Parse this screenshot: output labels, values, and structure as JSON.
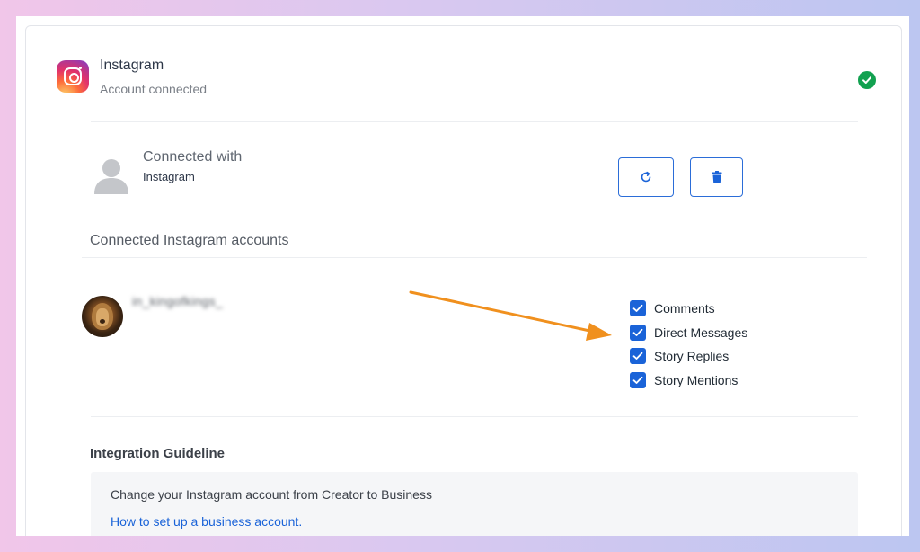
{
  "app": {
    "title": "Instagram",
    "status": "Account connected",
    "connected_icon": "check-circle-icon",
    "status_color": "#12a150"
  },
  "connection": {
    "title": "Connected with",
    "provider": "Instagram",
    "refresh_icon": "refresh-icon",
    "delete_icon": "trash-icon"
  },
  "accounts": {
    "section_label": "Connected Instagram accounts",
    "items": [
      {
        "username": "in_kingofkings_",
        "permissions": [
          {
            "label": "Comments",
            "checked": true
          },
          {
            "label": "Direct Messages",
            "checked": true
          },
          {
            "label": "Story Replies",
            "checked": true
          },
          {
            "label": "Story Mentions",
            "checked": true
          }
        ]
      }
    ]
  },
  "guideline": {
    "title": "Integration Guideline",
    "text": "Change your Instagram account from Creator to Business",
    "link_text": "How to set up a business account."
  },
  "colors": {
    "accent": "#1a63d8",
    "annotation_arrow": "#f0901e"
  }
}
